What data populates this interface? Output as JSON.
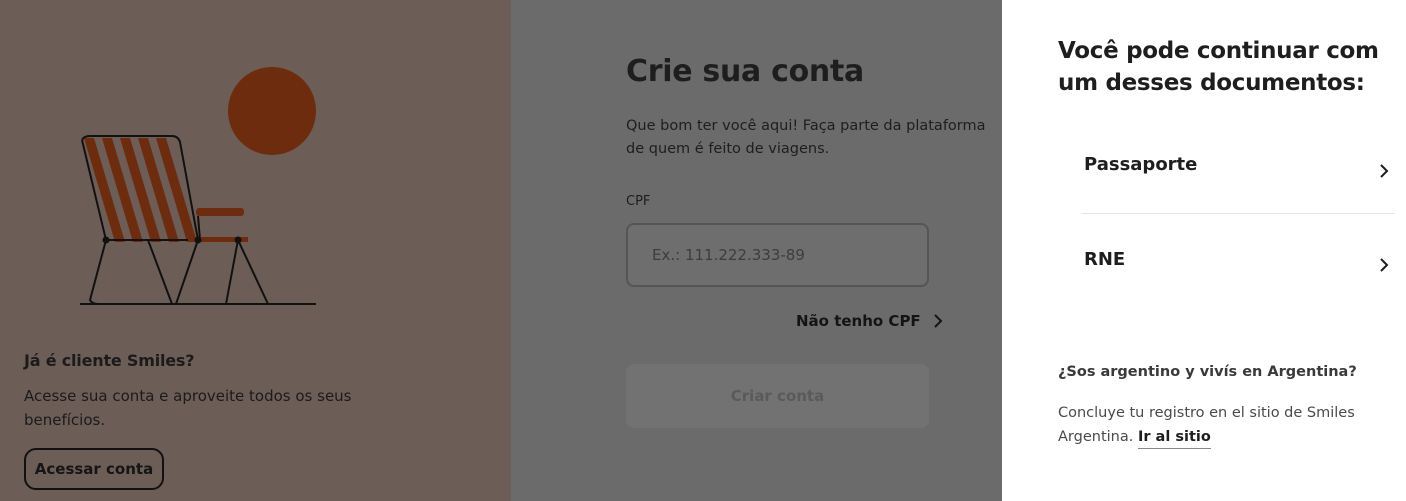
{
  "promo": {
    "title": "Já é cliente Smiles?",
    "text": "Acesse sua conta e aproveite todos os seus benefícios.",
    "login_label": "Acessar conta"
  },
  "form": {
    "title": "Crie sua conta",
    "subtitle": "Que bom ter você aqui! Faça parte da plataforma de quem é feito de viagens.",
    "cpf_label": "CPF",
    "cpf_placeholder": "Ex.: 111.222.333-89",
    "cpf_value": "",
    "no_cpf_label": "Não tenho CPF",
    "create_label": "Criar conta"
  },
  "sheet": {
    "title": "Você pode continuar com um desses documentos:",
    "documents": [
      {
        "label": "Passaporte",
        "icon": "chevron-right-icon"
      },
      {
        "label": "RNE",
        "icon": "chevron-right-icon"
      }
    ],
    "argentina_question": "¿Sos argentino y vivís en Argentina?",
    "argentina_text": "Concluye tu registro en el sitio de Smiles Argentina.",
    "argentina_link": "Ir al sitio"
  },
  "colors": {
    "overlay_left": "#6c5d57",
    "overlay_middle": "#6b6b6b",
    "sheet_bg": "#ffffff",
    "illustration_accent": "#6e2c0f"
  }
}
